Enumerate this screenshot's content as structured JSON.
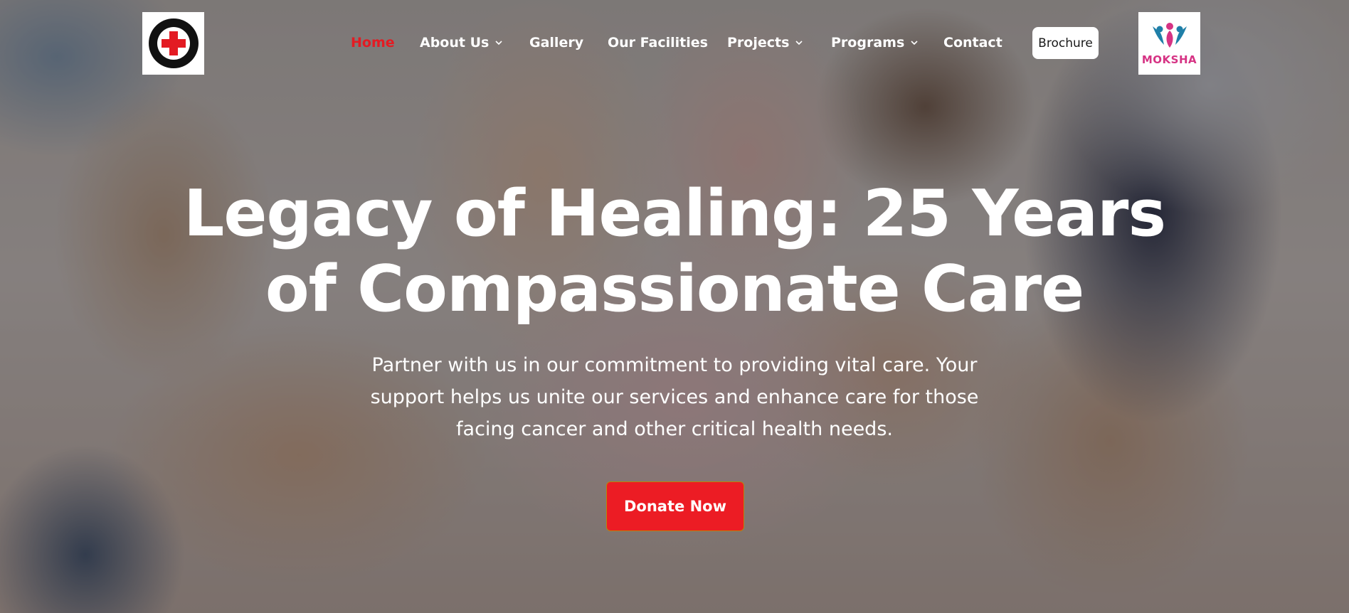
{
  "nav": {
    "items": [
      {
        "label": "Home",
        "active": true,
        "dropdown": false
      },
      {
        "label": "About Us",
        "active": false,
        "dropdown": true
      },
      {
        "label": "Gallery",
        "active": false,
        "dropdown": false
      },
      {
        "label": "Our Facilities",
        "active": false,
        "dropdown": false
      },
      {
        "label": "Projects",
        "active": false,
        "dropdown": true
      },
      {
        "label": "Programs",
        "active": false,
        "dropdown": true
      },
      {
        "label": "Contact",
        "active": false,
        "dropdown": false
      }
    ],
    "brochure_label": "Brochure"
  },
  "logos": {
    "left": {
      "icon": "red-cross-seal-icon"
    },
    "right": {
      "text": "MOKSHA",
      "icon": "moksha-figures-icon"
    }
  },
  "hero": {
    "title_line1": "Legacy of Healing: 25 Years",
    "title_line2": "of Compassionate Care",
    "subtitle_line1": "Partner with us in our commitment to providing vital care. Your",
    "subtitle_line2": "support helps us unite our services and enhance care for those",
    "subtitle_line3": "facing cancer and other critical health needs.",
    "cta_label": "Donate Now"
  },
  "colors": {
    "accent": "#e31b23",
    "cta": "#ec1c24",
    "nav_text": "#ffffff",
    "brand_pink": "#d63384"
  }
}
